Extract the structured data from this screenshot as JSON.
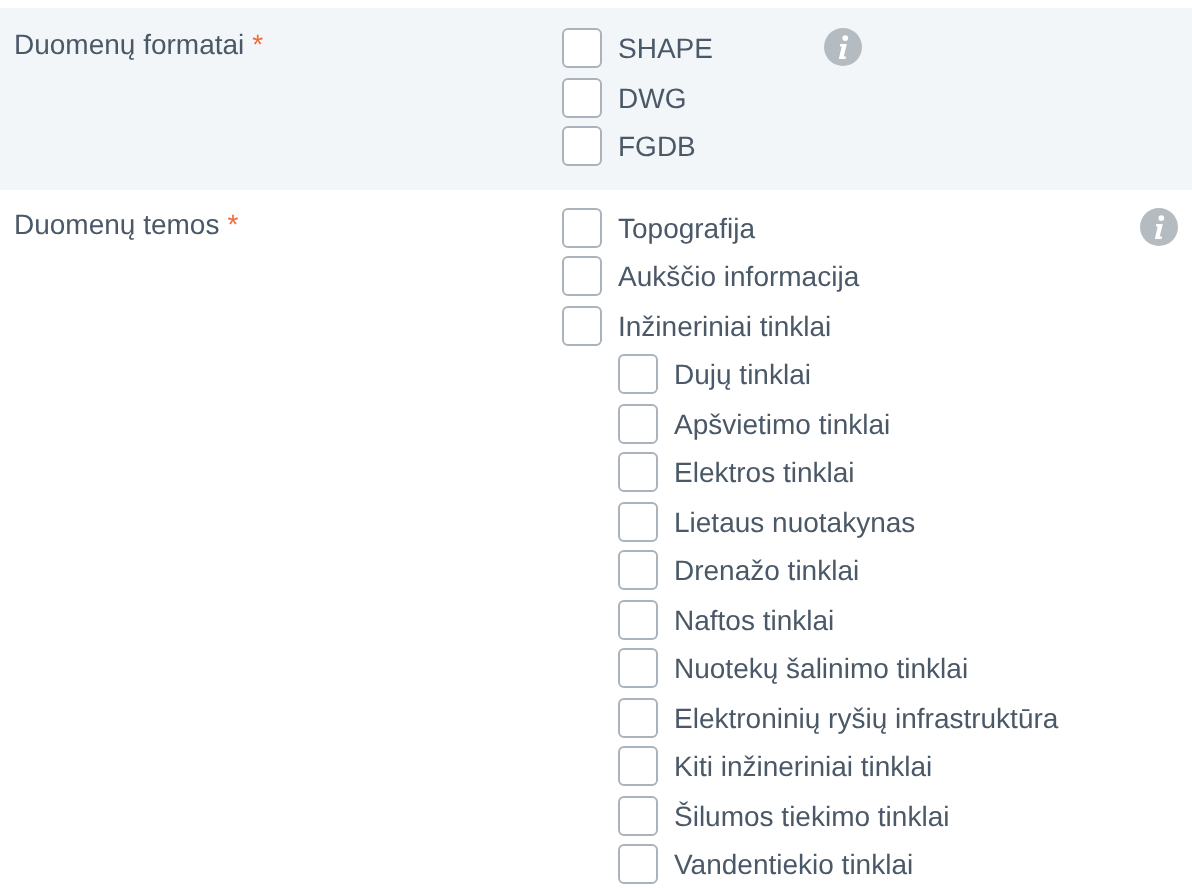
{
  "sections": [
    {
      "label": "Duomenų formatai",
      "required": "*",
      "options": [
        {
          "label": "SHAPE",
          "checked": false
        },
        {
          "label": "DWG",
          "checked": false
        },
        {
          "label": "FGDB",
          "checked": false
        }
      ]
    },
    {
      "label": "Duomenų temos",
      "required": "*",
      "options": [
        {
          "label": "Topografija",
          "checked": false
        },
        {
          "label": "Aukščio informacija",
          "checked": false
        },
        {
          "label": "Inžineriniai tinklai",
          "checked": false,
          "children": [
            {
              "label": "Dujų tinklai",
              "checked": false
            },
            {
              "label": "Apšvietimo tinklai",
              "checked": false
            },
            {
              "label": "Elektros tinklai",
              "checked": false
            },
            {
              "label": "Lietaus nuotakynas",
              "checked": false
            },
            {
              "label": "Drenažo tinklai",
              "checked": false
            },
            {
              "label": "Naftos tinklai",
              "checked": false
            },
            {
              "label": "Nuotekų šalinimo tinklai",
              "checked": false
            },
            {
              "label": "Elektroninių ryšių infrastruktūra",
              "checked": false
            },
            {
              "label": "Kiti inžineriniai tinklai",
              "checked": false
            },
            {
              "label": "Šilumos tiekimo tinklai",
              "checked": false
            },
            {
              "label": "Vandentiekio tinklai",
              "checked": false
            }
          ]
        }
      ]
    }
  ]
}
